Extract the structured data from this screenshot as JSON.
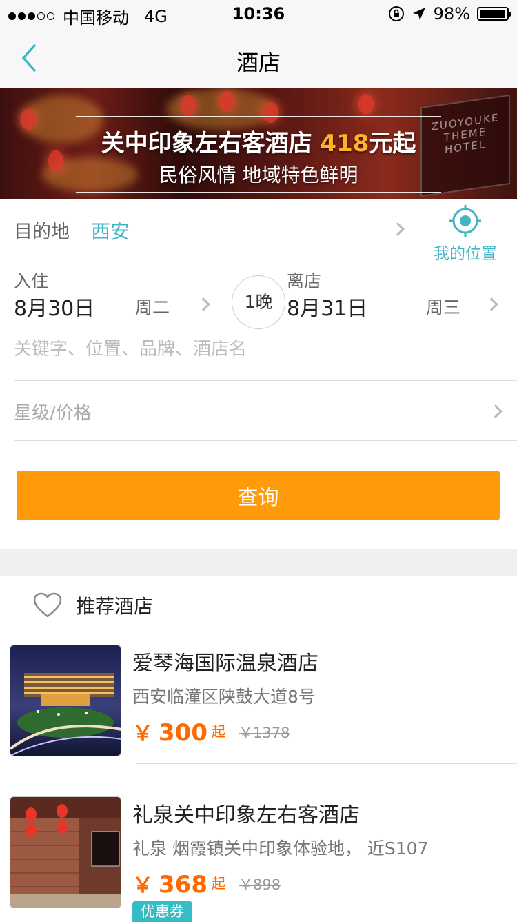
{
  "status_bar": {
    "carrier": "中国移动",
    "network": "4G",
    "time": "10:36",
    "battery": "98%",
    "battery_level": 0.98
  },
  "nav": {
    "title": "酒店"
  },
  "banner": {
    "line1_pre": "关中印象左右客酒店 ",
    "line1_hl": "418",
    "line1_post": "元起",
    "line2": "民俗风情 地域特色鲜明",
    "sign_text": "ZUOYOUKE THEME HOTEL"
  },
  "form": {
    "destination_label": "目的地",
    "destination_value": "西安",
    "my_location_label": "我的位置",
    "checkin_label": "入住",
    "checkin_date": "8月30日",
    "checkin_weekday": "周二",
    "nights": "1晚",
    "checkout_label": "离店",
    "checkout_date": "8月31日",
    "checkout_weekday": "周三",
    "keyword_placeholder": "关键字、位置、品牌、酒店名",
    "star_price_label": "星级/价格",
    "search_button": "查询"
  },
  "recommend": {
    "title": "推荐酒店",
    "hotels": [
      {
        "name": "爱琴海国际温泉酒店",
        "address": "西安临潼区陕鼓大道8号",
        "currency": "￥",
        "price": "300",
        "suffix": "起",
        "original": "￥1378"
      },
      {
        "name": "礼泉关中印象左右客酒店",
        "address": "礼泉 烟霞镇关中印象体验地， 近S107",
        "currency": "￥",
        "price": "368",
        "suffix": "起",
        "original": "￥898",
        "badge": "优惠券"
      }
    ]
  },
  "colors": {
    "accent": "#3fb5c6",
    "button": "#ff9a0a",
    "price": "#ff6a00"
  }
}
